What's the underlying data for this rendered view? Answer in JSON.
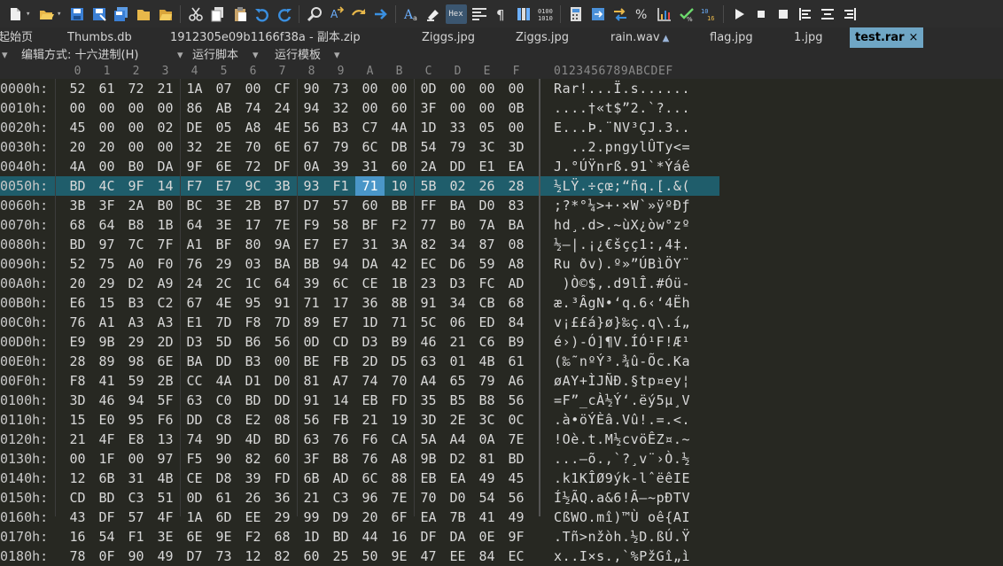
{
  "toolbar": {
    "groups": [
      [
        "new-file-icon",
        "open-folder-icon",
        "save-icon",
        "save-as-icon",
        "save-all-icon",
        "folder-icon",
        "folder-open-icon"
      ],
      [
        "cut-icon",
        "copy-icon",
        "paste-icon",
        "undo-icon",
        "redo-icon"
      ],
      [
        "find-icon",
        "replace-icon",
        "find-next-icon",
        "goto-icon"
      ],
      [
        "font-icon",
        "highlight-icon",
        "hex-mode-icon",
        "format-icon",
        "paragraph-icon",
        "columns-icon",
        "binary-icon"
      ],
      [
        "calculator-icon",
        "convert-icon",
        "swap-icon",
        "percent-icon",
        "chart-icon",
        "checksum-icon",
        "base-convert-icon"
      ],
      [
        "play-icon",
        "stop-icon",
        "record-icon",
        "align-left-icon",
        "align-center-icon",
        "align-right-icon"
      ]
    ],
    "hex_label": "Hex"
  },
  "tabs": [
    {
      "label": "起始页",
      "active": false
    },
    {
      "label": "Thumbs.db",
      "active": false
    },
    {
      "label": "1912305e09b1166f38a - 副本.zip",
      "active": false
    },
    {
      "label": "Ziggs.jpg",
      "active": false
    },
    {
      "label": "Ziggs.jpg",
      "active": false
    },
    {
      "label": "rain.wav",
      "active": false,
      "locked": true
    },
    {
      "label": "flag.jpg",
      "active": false
    },
    {
      "label": "1.jpg",
      "active": false
    },
    {
      "label": "test.rar",
      "active": true,
      "close": "×"
    }
  ],
  "menubar": {
    "expand_icon": "▾",
    "edit_mode": "编辑方式: 十六进制(H)",
    "run_script": "运行脚本",
    "run_template": "运行模板",
    "dropdown": "▾"
  },
  "columns": [
    "0",
    "1",
    "2",
    "3",
    "4",
    "5",
    "6",
    "7",
    "8",
    "9",
    "A",
    "B",
    "C",
    "D",
    "E",
    "F"
  ],
  "ascii_header": "0123456789ABCDEF",
  "selected_row": 5,
  "cursor_col": 10,
  "rows": [
    {
      "addr": "0000h:",
      "bytes": [
        "52",
        "61",
        "72",
        "21",
        "1A",
        "07",
        "00",
        "CF",
        "90",
        "73",
        "00",
        "00",
        "0D",
        "00",
        "00",
        "00"
      ],
      "ascii": "Rar!...Ï.s......"
    },
    {
      "addr": "0010h:",
      "bytes": [
        "00",
        "00",
        "00",
        "00",
        "86",
        "AB",
        "74",
        "24",
        "94",
        "32",
        "00",
        "60",
        "3F",
        "00",
        "00",
        "0B"
      ],
      "ascii": "....†«t$”2.`?..."
    },
    {
      "addr": "0020h:",
      "bytes": [
        "45",
        "00",
        "00",
        "02",
        "DE",
        "05",
        "A8",
        "4E",
        "56",
        "B3",
        "C7",
        "4A",
        "1D",
        "33",
        "05",
        "00"
      ],
      "ascii": "E...Þ.¨NV³ÇJ.3.."
    },
    {
      "addr": "0030h:",
      "bytes": [
        "20",
        "20",
        "00",
        "00",
        "32",
        "2E",
        "70",
        "6E",
        "67",
        "79",
        "6C",
        "DB",
        "54",
        "79",
        "3C",
        "3D"
      ],
      "ascii": "  ..2.pngylÛTy<="
    },
    {
      "addr": "0040h:",
      "bytes": [
        "4A",
        "00",
        "B0",
        "DA",
        "9F",
        "6E",
        "72",
        "DF",
        "0A",
        "39",
        "31",
        "60",
        "2A",
        "DD",
        "E1",
        "EA"
      ],
      "ascii": "J.°ÚŸnrß.91`*Ýáê"
    },
    {
      "addr": "0050h:",
      "bytes": [
        "BD",
        "4C",
        "9F",
        "14",
        "F7",
        "E7",
        "9C",
        "3B",
        "93",
        "F1",
        "71",
        "10",
        "5B",
        "02",
        "26",
        "28"
      ],
      "ascii": "½LŸ.÷çœ;“ñq.[.&("
    },
    {
      "addr": "0060h:",
      "bytes": [
        "3B",
        "3F",
        "2A",
        "B0",
        "BC",
        "3E",
        "2B",
        "B7",
        "D7",
        "57",
        "60",
        "BB",
        "FF",
        "BA",
        "D0",
        "83"
      ],
      "ascii": ";?*°¼>+·×W`»ÿºÐƒ"
    },
    {
      "addr": "0070h:",
      "bytes": [
        "68",
        "64",
        "B8",
        "1B",
        "64",
        "3E",
        "17",
        "7E",
        "F9",
        "58",
        "BF",
        "F2",
        "77",
        "B0",
        "7A",
        "BA"
      ],
      "ascii": "hd¸.d>.~ùX¿òw°zº"
    },
    {
      "addr": "0080h:",
      "bytes": [
        "BD",
        "97",
        "7C",
        "7F",
        "A1",
        "BF",
        "80",
        "9A",
        "E7",
        "E7",
        "31",
        "3A",
        "82",
        "34",
        "87",
        "08"
      ],
      "ascii": "½—|.¡¿€šçç1:‚4‡."
    },
    {
      "addr": "0090h:",
      "bytes": [
        "52",
        "75",
        "A0",
        "F0",
        "76",
        "29",
        "03",
        "BA",
        "BB",
        "94",
        "DA",
        "42",
        "EC",
        "D6",
        "59",
        "A8"
      ],
      "ascii": "Ru ðv).º»”ÚBìÖY¨"
    },
    {
      "addr": "00A0h:",
      "bytes": [
        "20",
        "29",
        "D2",
        "A9",
        "24",
        "2C",
        "1C",
        "64",
        "39",
        "6C",
        "CE",
        "1B",
        "23",
        "D3",
        "FC",
        "AD"
      ],
      "ascii": " )Ò©$,.d9lÎ.#Óü-"
    },
    {
      "addr": "00B0h:",
      "bytes": [
        "E6",
        "15",
        "B3",
        "C2",
        "67",
        "4E",
        "95",
        "91",
        "71",
        "17",
        "36",
        "8B",
        "91",
        "34",
        "CB",
        "68"
      ],
      "ascii": "æ.³ÂgN•‘q.6‹‘4Ëh"
    },
    {
      "addr": "00C0h:",
      "bytes": [
        "76",
        "A1",
        "A3",
        "A3",
        "E1",
        "7D",
        "F8",
        "7D",
        "89",
        "E7",
        "1D",
        "71",
        "5C",
        "06",
        "ED",
        "84"
      ],
      "ascii": "v¡££á}ø}‰ç.q\\.í„"
    },
    {
      "addr": "00D0h:",
      "bytes": [
        "E9",
        "9B",
        "29",
        "2D",
        "D3",
        "5D",
        "B6",
        "56",
        "0D",
        "CD",
        "D3",
        "B9",
        "46",
        "21",
        "C6",
        "B9"
      ],
      "ascii": "é›)-Ó]¶V.ÍÓ¹F!Æ¹"
    },
    {
      "addr": "00E0h:",
      "bytes": [
        "28",
        "89",
        "98",
        "6E",
        "BA",
        "DD",
        "B3",
        "00",
        "BE",
        "FB",
        "2D",
        "D5",
        "63",
        "01",
        "4B",
        "61"
      ],
      "ascii": "(‰˜nºÝ³.¾û-Õc.Ka"
    },
    {
      "addr": "00F0h:",
      "bytes": [
        "F8",
        "41",
        "59",
        "2B",
        "CC",
        "4A",
        "D1",
        "D0",
        "81",
        "A7",
        "74",
        "70",
        "A4",
        "65",
        "79",
        "A6"
      ],
      "ascii": "øAY+ÌJÑÐ.§tp¤ey¦"
    },
    {
      "addr": "0100h:",
      "bytes": [
        "3D",
        "46",
        "94",
        "5F",
        "63",
        "C0",
        "BD",
        "DD",
        "91",
        "14",
        "EB",
        "FD",
        "35",
        "B5",
        "B8",
        "56"
      ],
      "ascii": "=F”_cÀ½Ý‘.ëý5µ¸V"
    },
    {
      "addr": "0110h:",
      "bytes": [
        "15",
        "E0",
        "95",
        "F6",
        "DD",
        "C8",
        "E2",
        "08",
        "56",
        "FB",
        "21",
        "19",
        "3D",
        "2E",
        "3C",
        "0C"
      ],
      "ascii": ".à•öÝÈâ.Vû!.=.<."
    },
    {
      "addr": "0120h:",
      "bytes": [
        "21",
        "4F",
        "E8",
        "13",
        "74",
        "9D",
        "4D",
        "BD",
        "63",
        "76",
        "F6",
        "CA",
        "5A",
        "A4",
        "0A",
        "7E"
      ],
      "ascii": "!Oè.t.M½cvöÊZ¤.~"
    },
    {
      "addr": "0130h:",
      "bytes": [
        "00",
        "1F",
        "00",
        "97",
        "F5",
        "90",
        "82",
        "60",
        "3F",
        "B8",
        "76",
        "A8",
        "9B",
        "D2",
        "81",
        "BD"
      ],
      "ascii": "...—õ.‚`?¸v¨›Ò.½"
    },
    {
      "addr": "0140h:",
      "bytes": [
        "12",
        "6B",
        "31",
        "4B",
        "CE",
        "D8",
        "39",
        "FD",
        "6B",
        "AD",
        "6C",
        "88",
        "EB",
        "EA",
        "49",
        "45"
      ],
      "ascii": ".k1KÎØ9ýk-lˆëêIE"
    },
    {
      "addr": "0150h:",
      "bytes": [
        "CD",
        "BD",
        "C3",
        "51",
        "0D",
        "61",
        "26",
        "36",
        "21",
        "C3",
        "96",
        "7E",
        "70",
        "D0",
        "54",
        "56"
      ],
      "ascii": "Í½ÃQ.a&6!Ã–~pÐTV"
    },
    {
      "addr": "0160h:",
      "bytes": [
        "43",
        "DF",
        "57",
        "4F",
        "1A",
        "6D",
        "EE",
        "29",
        "99",
        "D9",
        "20",
        "6F",
        "EA",
        "7B",
        "41",
        "49"
      ],
      "ascii": "CßWO.mî)™Ù oê{AI"
    },
    {
      "addr": "0170h:",
      "bytes": [
        "16",
        "54",
        "F1",
        "3E",
        "6E",
        "9E",
        "F2",
        "68",
        "1D",
        "BD",
        "44",
        "16",
        "DF",
        "DA",
        "0E",
        "9F"
      ],
      "ascii": ".Tñ>nžòh.½D.ßÚ.Ÿ"
    },
    {
      "addr": "0180h:",
      "bytes": [
        "78",
        "0F",
        "90",
        "49",
        "D7",
        "73",
        "12",
        "82",
        "60",
        "25",
        "50",
        "9E",
        "47",
        "EE",
        "84",
        "EC"
      ],
      "ascii": "x..I×s.‚`%PžGî„ì"
    }
  ]
}
